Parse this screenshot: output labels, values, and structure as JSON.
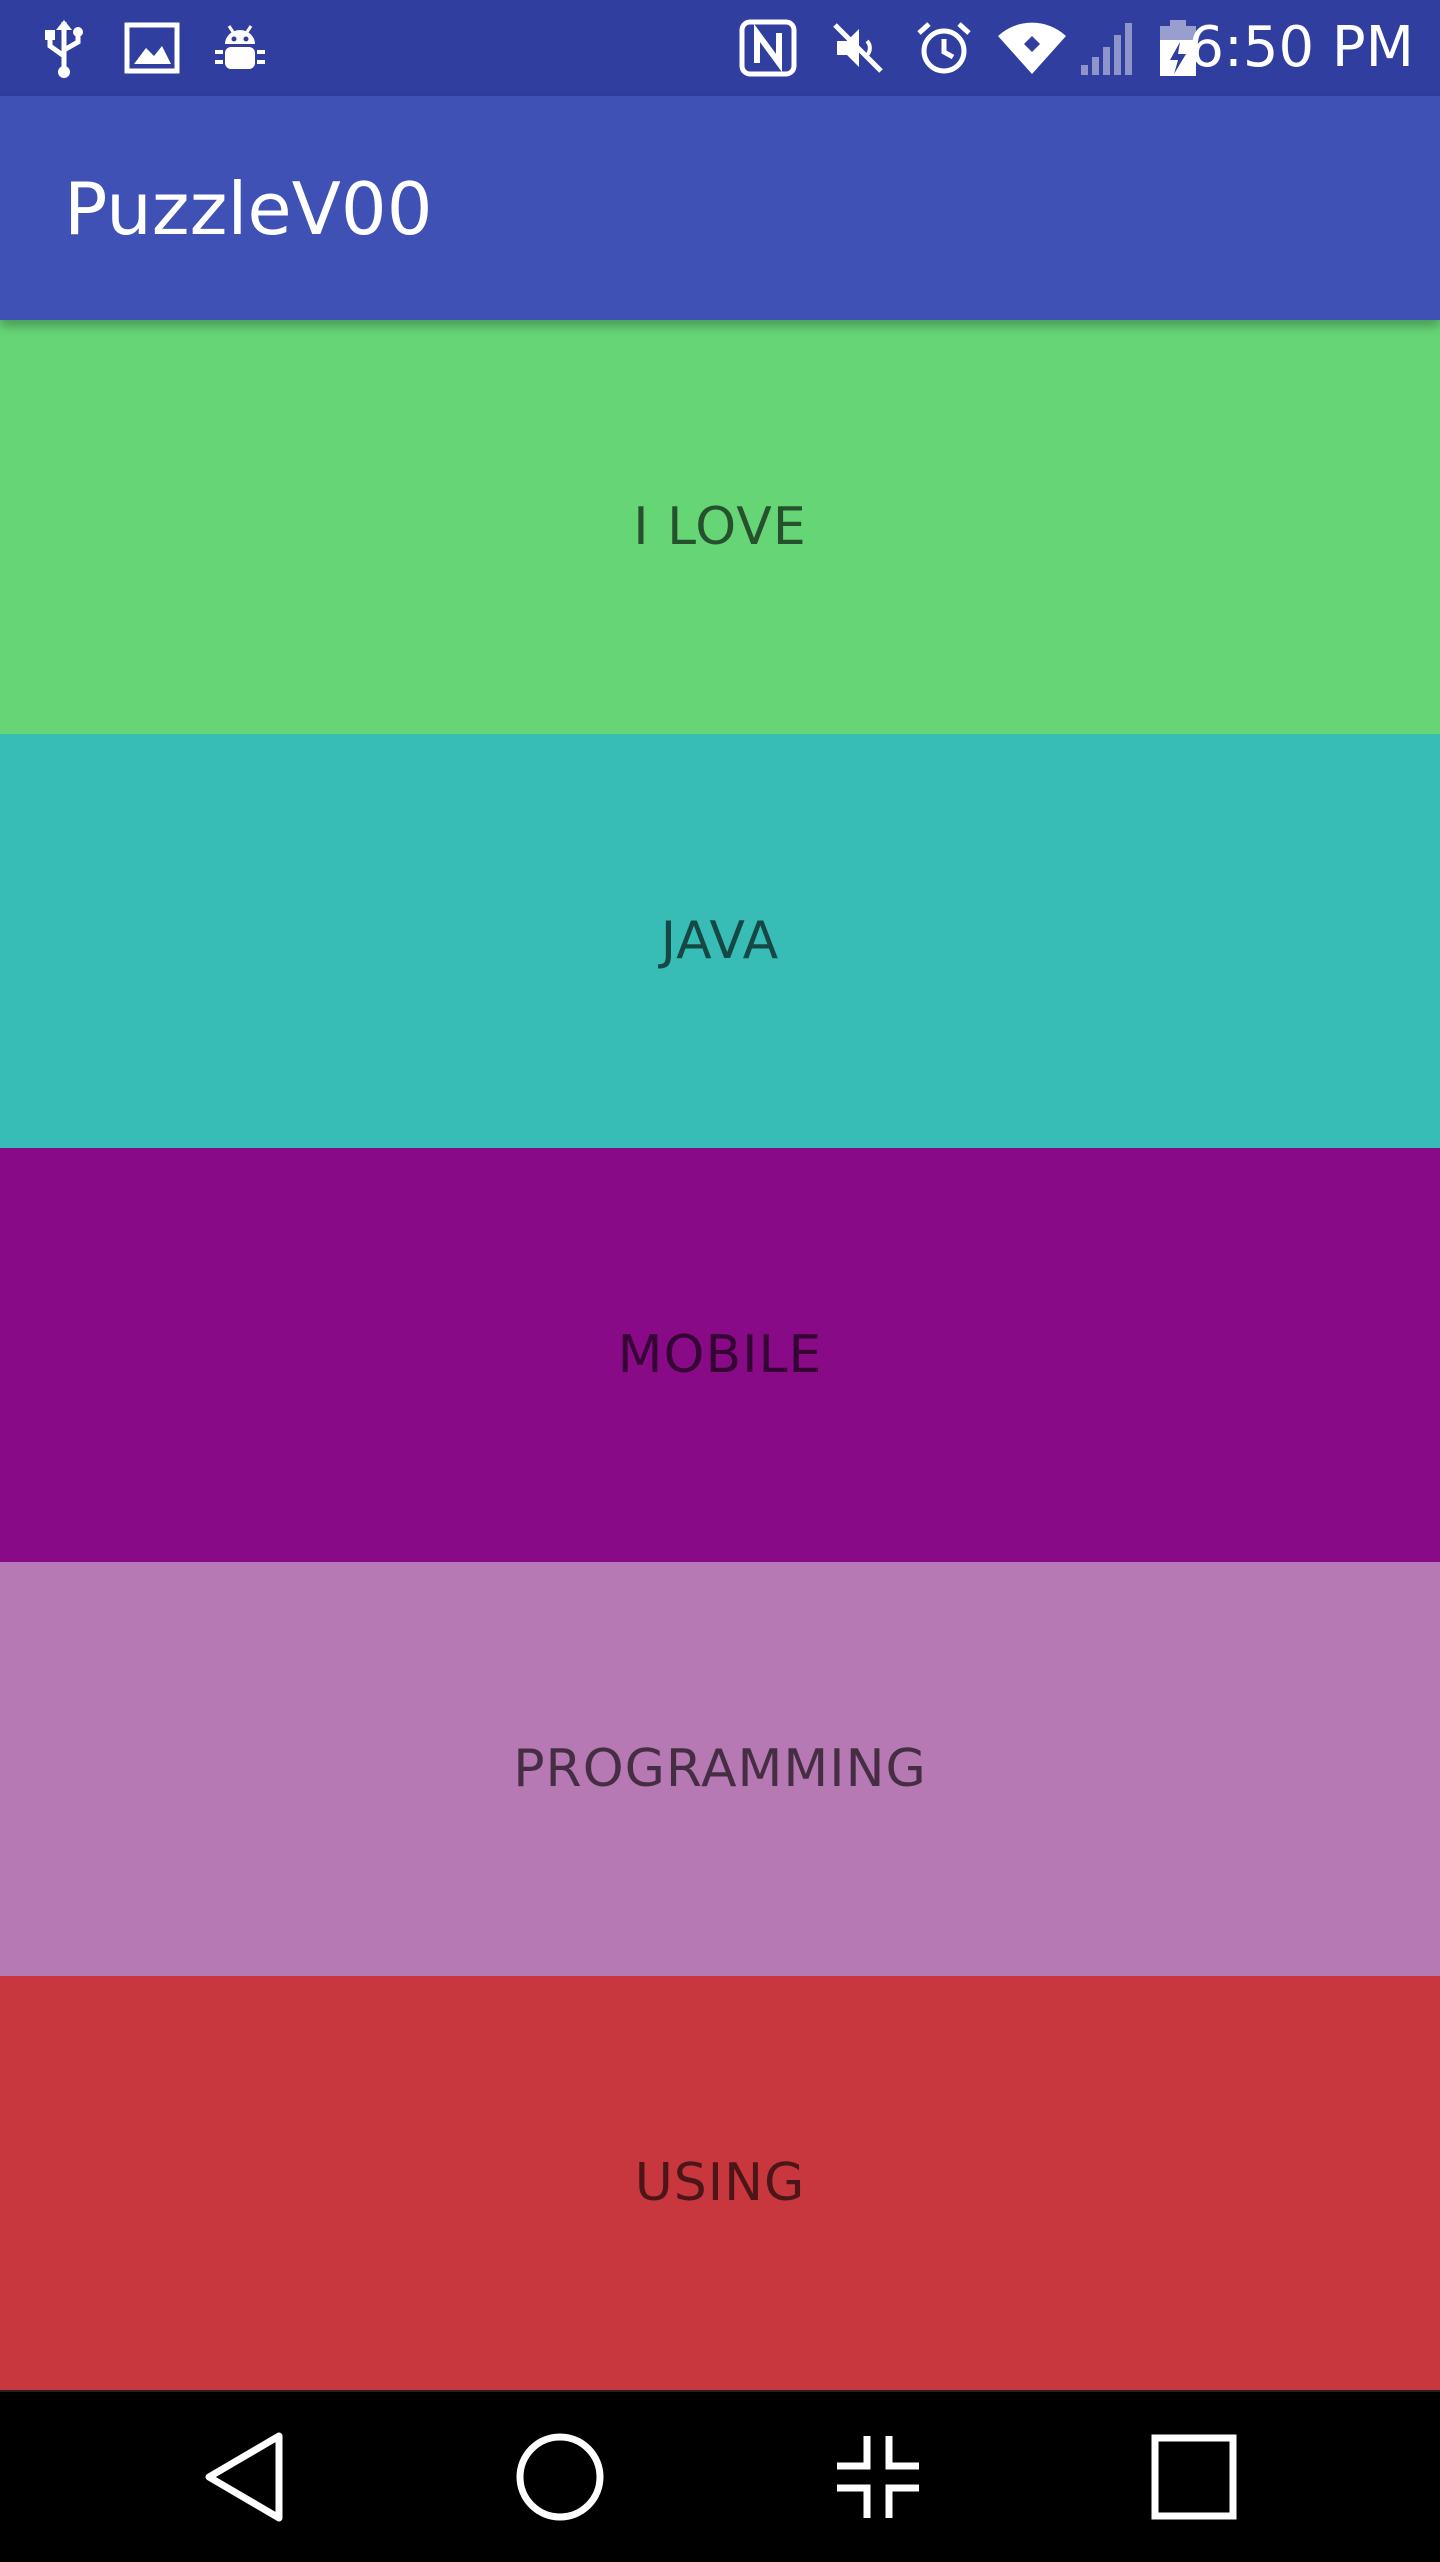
{
  "status_bar": {
    "time": "6:50 PM",
    "icons": [
      "usb-icon",
      "image-icon",
      "android-debug-icon",
      "nfc-icon",
      "mute-icon",
      "alarm-icon",
      "wifi-icon",
      "signal-icon",
      "battery-charging-icon"
    ]
  },
  "app_bar": {
    "title": "PuzzleV00"
  },
  "blocks": [
    {
      "label": "I LOVE",
      "color": "#66D576"
    },
    {
      "label": "JAVA",
      "color": "#37BDB6"
    },
    {
      "label": "MOBILE",
      "color": "#880A87"
    },
    {
      "label": "PROGRAMMING",
      "color": "#B679B3"
    },
    {
      "label": "USING",
      "color": "#C8373D"
    }
  ],
  "nav_bar": {
    "buttons": [
      "back-icon",
      "home-icon",
      "dual-window-icon",
      "recents-icon"
    ]
  }
}
